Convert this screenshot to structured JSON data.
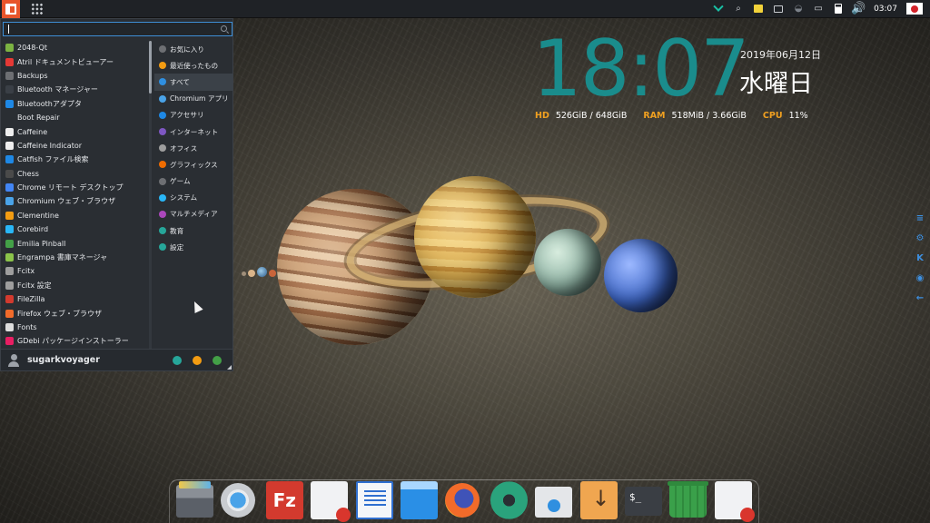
{
  "top_panel": {
    "clock": "03:07"
  },
  "start_menu": {
    "search": {
      "value": "",
      "placeholder": ""
    },
    "apps": [
      {
        "label": "2048-Qt",
        "color": "#7cb342"
      },
      {
        "label": "Atril ドキュメントビューアー",
        "color": "#e53935"
      },
      {
        "label": "Backups",
        "color": "#6d6f73"
      },
      {
        "label": "Bluetooth マネージャー",
        "color": "#3a3f46"
      },
      {
        "label": "Bluetoothアダプタ",
        "color": "#1e88e5"
      },
      {
        "label": "Boot Repair",
        "color": "#2a2e33"
      },
      {
        "label": "Caffeine",
        "color": "#eeeeee"
      },
      {
        "label": "Caffeine Indicator",
        "color": "#eeeeee"
      },
      {
        "label": "Catfish ファイル検索",
        "color": "#1e88e5"
      },
      {
        "label": "Chess",
        "color": "#4a4a4a"
      },
      {
        "label": "Chrome リモート デスクトップ",
        "color": "#4285f4"
      },
      {
        "label": "Chromium ウェブ・ブラウザ",
        "color": "#4aa3e8"
      },
      {
        "label": "Clementine",
        "color": "#f39c12"
      },
      {
        "label": "Corebird",
        "color": "#29b6f6"
      },
      {
        "label": "Emilia Pinball",
        "color": "#43a047"
      },
      {
        "label": "Engrampa 書庫マネージャ",
        "color": "#8bc34a"
      },
      {
        "label": "Fcitx",
        "color": "#9e9e9e"
      },
      {
        "label": "Fcitx 設定",
        "color": "#9e9e9e"
      },
      {
        "label": "FileZilla",
        "color": "#d33a2e"
      },
      {
        "label": "Firefox ウェブ・ブラウザ",
        "color": "#f26b2a"
      },
      {
        "label": "Fonts",
        "color": "#dddddd"
      },
      {
        "label": "GDebi パッケージインストーラー",
        "color": "#e91e63"
      }
    ],
    "categories": [
      {
        "label": "お気に入り",
        "color": "#6d6f73"
      },
      {
        "label": "最近使ったもの",
        "color": "#f39c12"
      },
      {
        "label": "すべて",
        "color": "#2f8fe0"
      },
      {
        "label": "Chromium アプリ",
        "color": "#4aa3e8"
      },
      {
        "label": "アクセサリ",
        "color": "#1e88e5"
      },
      {
        "label": "インターネット",
        "color": "#7e57c2"
      },
      {
        "label": "オフィス",
        "color": "#9e9e9e"
      },
      {
        "label": "グラフィックス",
        "color": "#ef6c00"
      },
      {
        "label": "ゲーム",
        "color": "#6d6f73"
      },
      {
        "label": "システム",
        "color": "#29b6f6"
      },
      {
        "label": "マルチメディア",
        "color": "#ab47bc"
      },
      {
        "label": "教育",
        "color": "#26a69a"
      },
      {
        "label": "設定",
        "color": "#26a69a"
      }
    ],
    "active_category": 2,
    "username": "sugarkvoyager",
    "footer_colors": [
      "#26a69a",
      "#f39c12",
      "#43a047"
    ]
  },
  "conky": {
    "time": "18:07",
    "date": "2019年06月12日",
    "weekday": "水曜日",
    "hd_label": "HD",
    "hd_value": "526GiB / 648GiB",
    "ram_label": "RAM",
    "ram_value": "518MiB / 3.66GiB",
    "cpu_label": "CPU",
    "cpu_value": "11%"
  },
  "side_dock": [
    "≡",
    "⚙",
    "K",
    "◉",
    "←"
  ],
  "dock": [
    "files",
    "chromium",
    "filezilla",
    "text-editor",
    "writer",
    "window",
    "firefox",
    "settings",
    "package-installer",
    "downloader",
    "terminal",
    "trash",
    "text-editor-2"
  ],
  "dock_terminal_text": "$_"
}
